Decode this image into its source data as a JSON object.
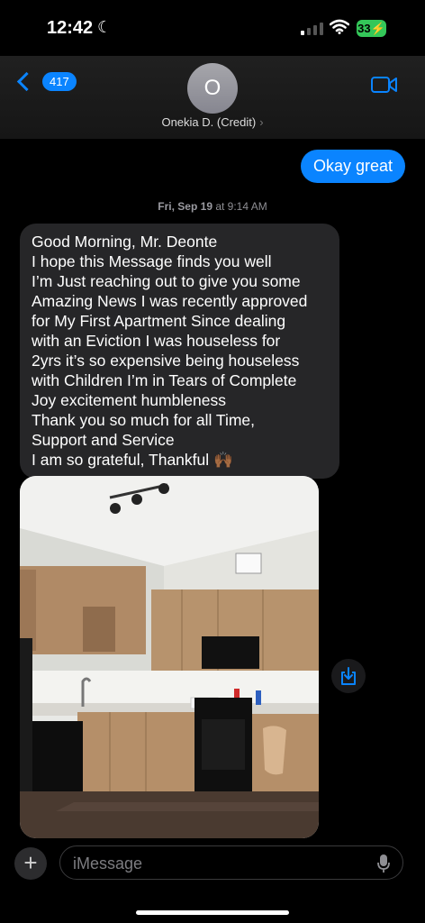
{
  "status_bar": {
    "time": "12:42",
    "battery": "33"
  },
  "header": {
    "back_count": "417",
    "avatar_initial": "O",
    "contact_name": "Onekia D. (Credit)"
  },
  "thread": {
    "outgoing": "Okay great",
    "timestamp_day": "Fri, Sep 19",
    "timestamp_time": " at 9:14 AM",
    "incoming_lines": [
      "Good Morning, Mr. Deonte",
      "I hope this Message finds you well",
      "I’m Just reaching out to give you some",
      "Amazing News I was recently approved",
      "for My First Apartment Since dealing",
      "with an Eviction I was houseless for",
      "2yrs it’s so expensive being houseless",
      "with Children I’m in Tears of Complete",
      "Joy excitement humbleness",
      "Thank you so much for all Time,",
      "Support and Service",
      "I am so grateful, Thankful"
    ],
    "incoming_emoji": "🙌🏾"
  },
  "composer": {
    "placeholder": "iMessage"
  },
  "colors": {
    "accent": "#0a84ff",
    "incoming_bubble": "#262628",
    "battery": "#34c759"
  }
}
